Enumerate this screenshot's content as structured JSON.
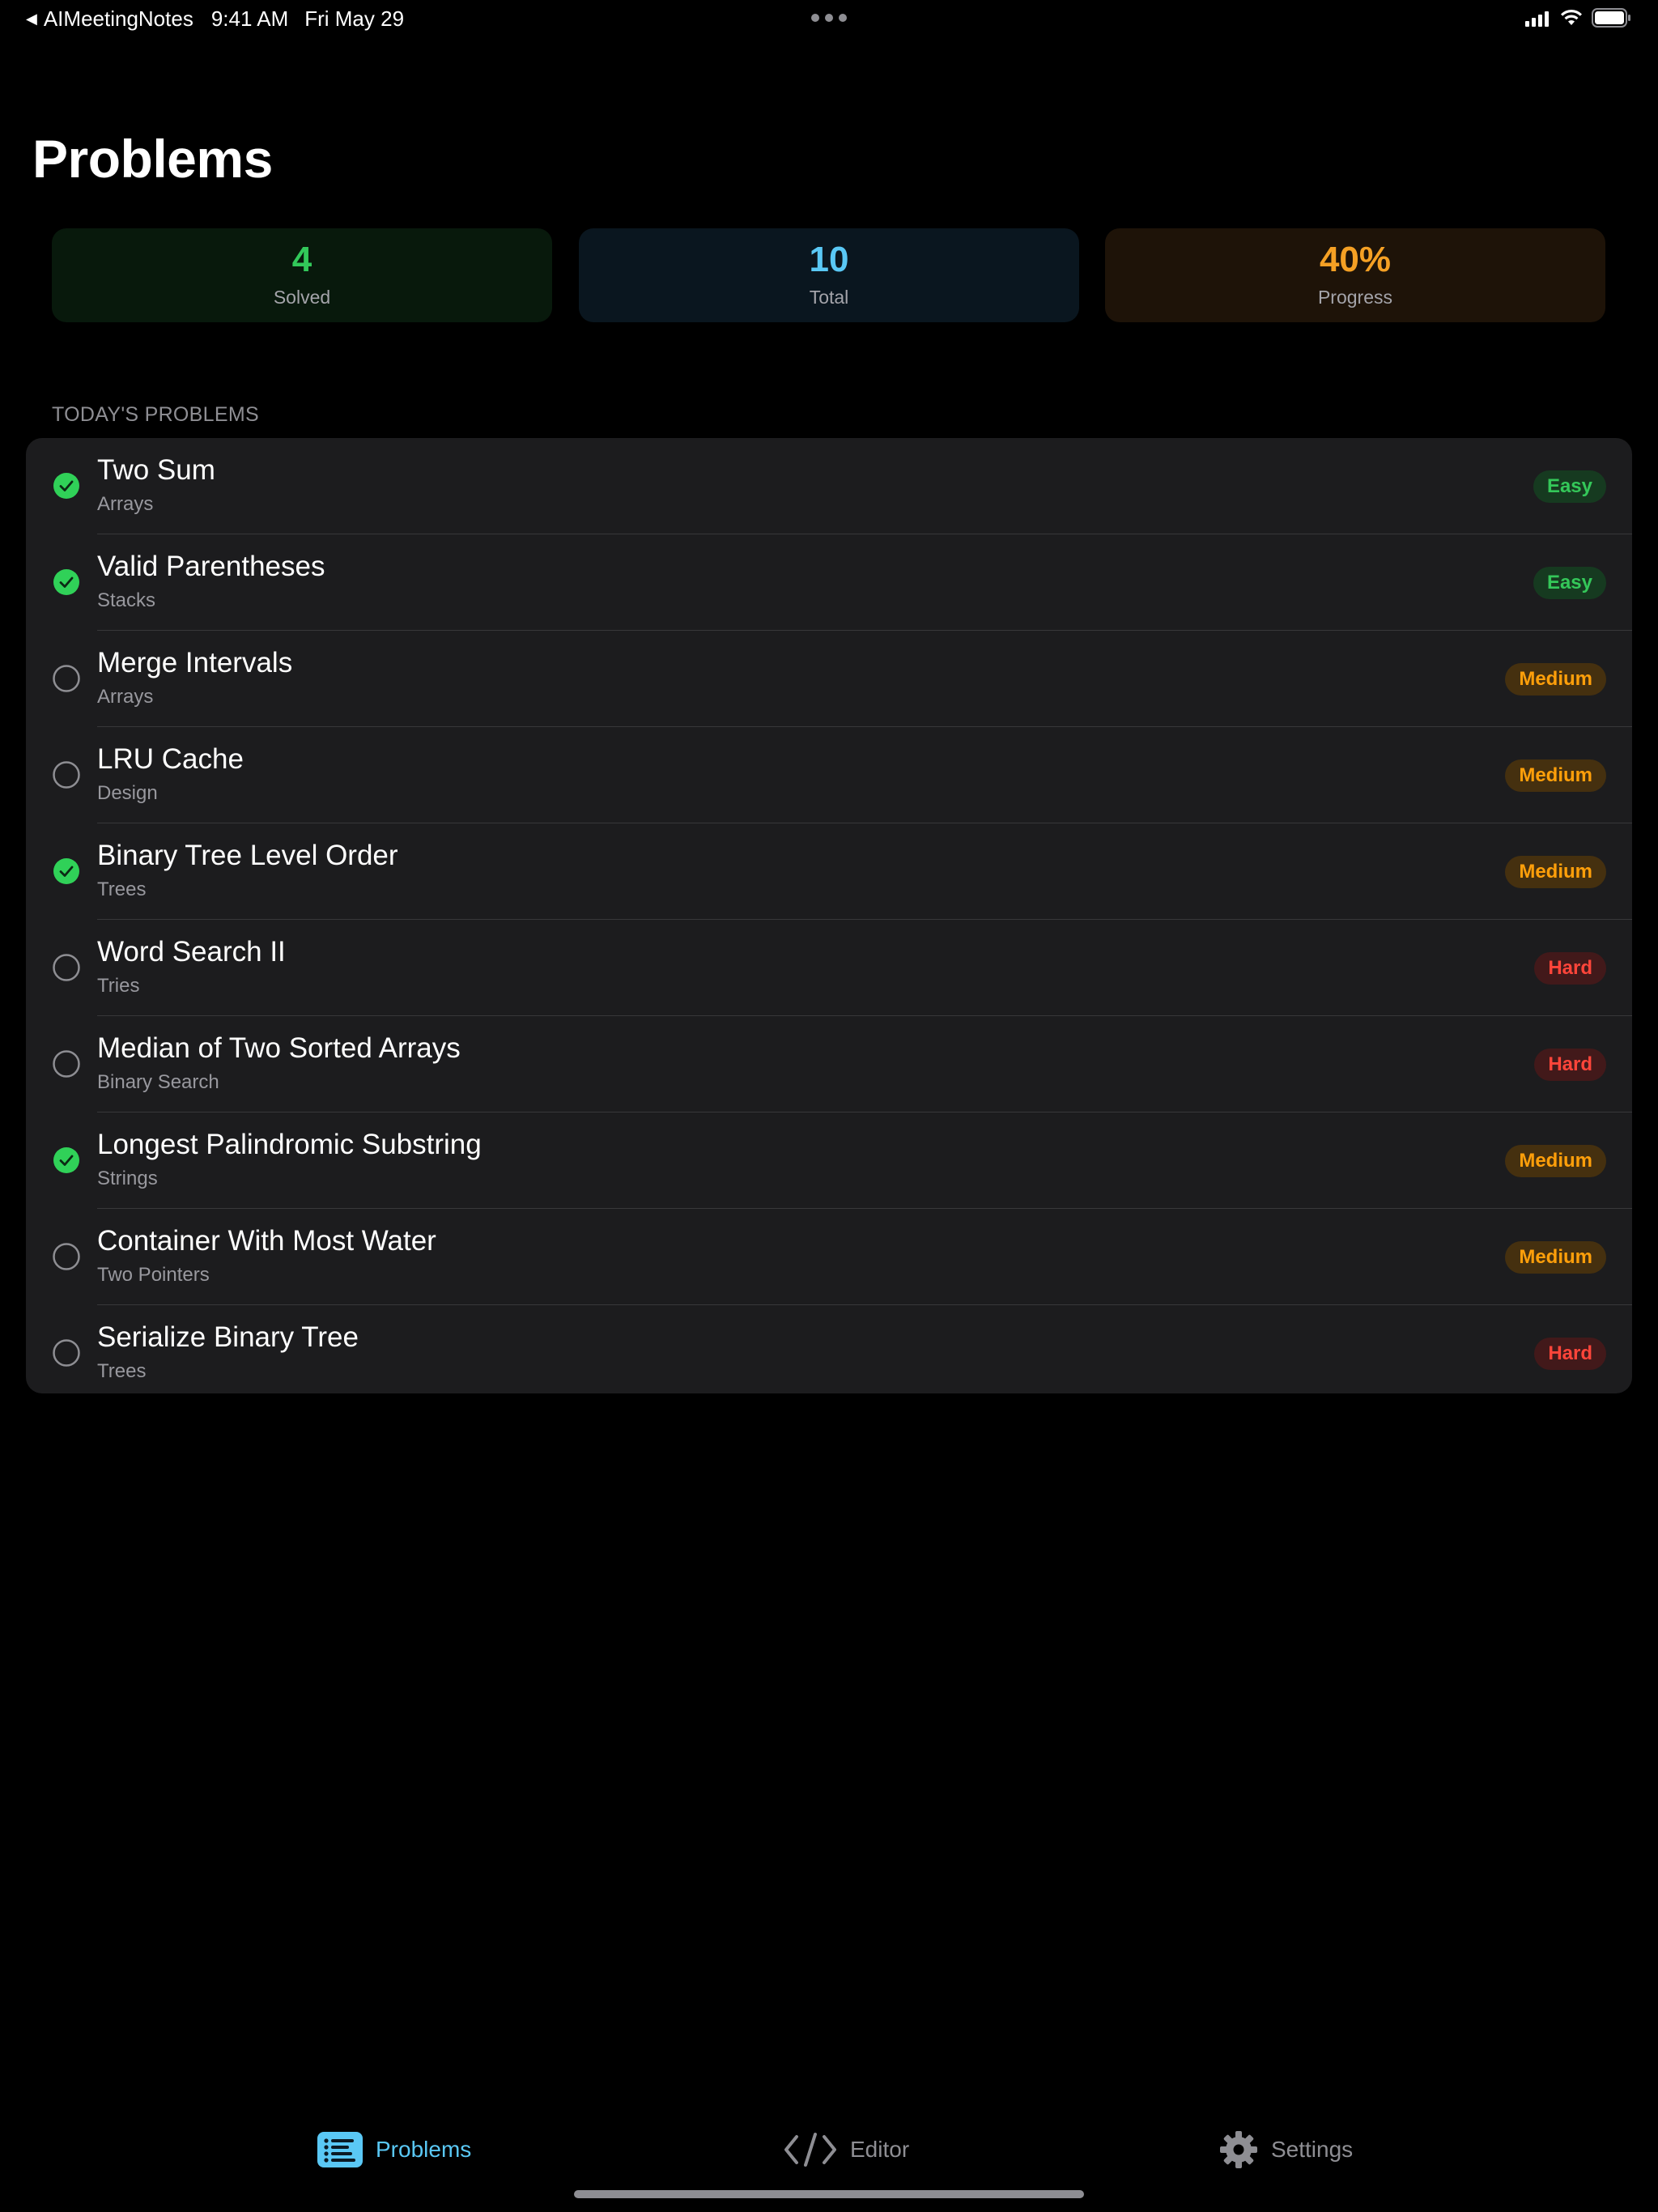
{
  "status_bar": {
    "back_app": "AIMeetingNotes",
    "time": "9:41 AM",
    "date": "Fri May 29"
  },
  "page": {
    "title": "Problems"
  },
  "stats": {
    "solved": {
      "value": "4",
      "label": "Solved",
      "color": "#32c85a"
    },
    "total": {
      "value": "10",
      "label": "Total",
      "color": "#5ac8f5"
    },
    "progress": {
      "value": "40%",
      "label": "Progress",
      "color": "#f5a024"
    }
  },
  "section": {
    "header": "TODAY'S PROBLEMS"
  },
  "problems": [
    {
      "title": "Two Sum",
      "category": "Arrays",
      "difficulty": "Easy",
      "solved": true
    },
    {
      "title": "Valid Parentheses",
      "category": "Stacks",
      "difficulty": "Easy",
      "solved": true
    },
    {
      "title": "Merge Intervals",
      "category": "Arrays",
      "difficulty": "Medium",
      "solved": false
    },
    {
      "title": "LRU Cache",
      "category": "Design",
      "difficulty": "Medium",
      "solved": false
    },
    {
      "title": "Binary Tree Level Order",
      "category": "Trees",
      "difficulty": "Medium",
      "solved": true
    },
    {
      "title": "Word Search II",
      "category": "Tries",
      "difficulty": "Hard",
      "solved": false
    },
    {
      "title": "Median of Two Sorted Arrays",
      "category": "Binary Search",
      "difficulty": "Hard",
      "solved": false
    },
    {
      "title": "Longest Palindromic Substring",
      "category": "Strings",
      "difficulty": "Medium",
      "solved": true
    },
    {
      "title": "Container With Most Water",
      "category": "Two Pointers",
      "difficulty": "Medium",
      "solved": false
    },
    {
      "title": "Serialize Binary Tree",
      "category": "Trees",
      "difficulty": "Hard",
      "solved": false
    }
  ],
  "tabs": {
    "problems": {
      "label": "Problems",
      "icon": "list-icon",
      "selected": true
    },
    "editor": {
      "label": "Editor",
      "icon": "code-icon",
      "selected": false
    },
    "settings": {
      "label": "Settings",
      "icon": "gear-icon",
      "selected": false
    }
  },
  "colors": {
    "accent": "#5ac8f5",
    "easy": "#34c759",
    "medium": "#ff9f0a",
    "hard": "#ff453a"
  }
}
